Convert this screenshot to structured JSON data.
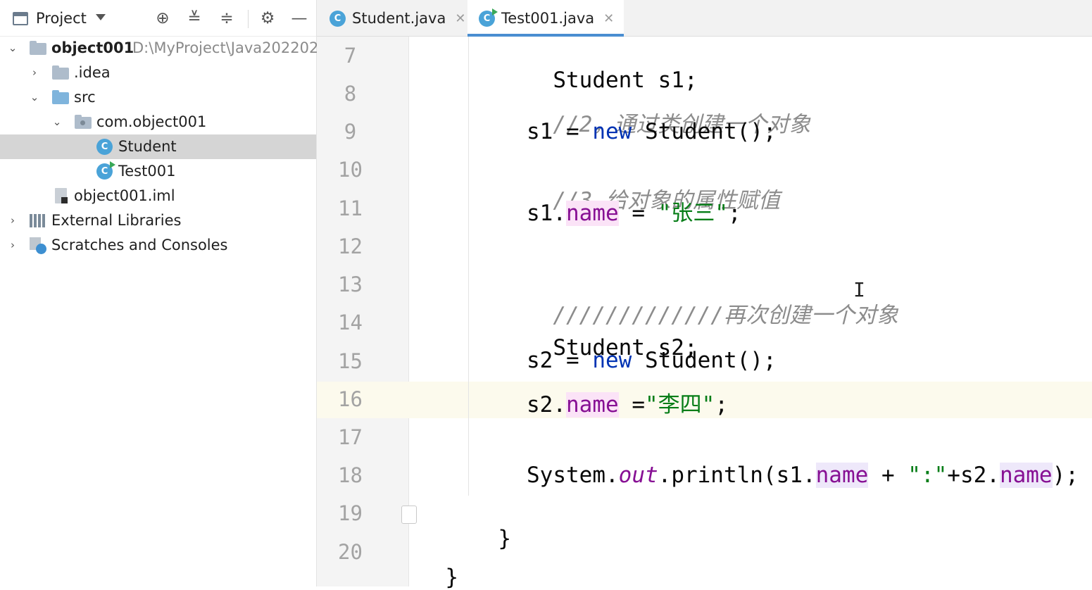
{
  "project_panel": {
    "title": "Project",
    "tree": [
      {
        "label": "object001",
        "path": "D:\\MyProject\\Java202202"
      },
      {
        "label": ".idea"
      },
      {
        "label": "src"
      },
      {
        "label": "com.object001"
      },
      {
        "label": "Student"
      },
      {
        "label": "Test001"
      },
      {
        "label": "object001.iml"
      },
      {
        "label": "External Libraries"
      },
      {
        "label": "Scratches and Consoles"
      }
    ]
  },
  "editor": {
    "tabs": [
      {
        "label": "Student.java"
      },
      {
        "label": "Test001.java"
      }
    ],
    "line_numbers": [
      "7",
      "8",
      "9",
      "10",
      "11",
      "12",
      "13",
      "14",
      "15",
      "16",
      "17",
      "18",
      "19",
      "20"
    ],
    "code": {
      "l7": "Student s1;",
      "l8": "//2，通过类创建一个对象",
      "l9_var": "s1 = ",
      "l9_kw": "new",
      "l9_rest": " Student();",
      "l10": "//3,给对象的属性赋值",
      "l11_obj": "s1.",
      "l11_field": "name",
      "l11_op": " = ",
      "l11_str": "\"张三\"",
      "l11_end": ";",
      "l13": "/////////////再次创建一个对象",
      "l14": "Student s2;",
      "l15_var": "s2 = ",
      "l15_kw": "new",
      "l15_rest": " Student();",
      "l16_obj": "s2.",
      "l16_field": "name",
      "l16_op": " =",
      "l16_str": "\"李四\"",
      "l16_end": ";",
      "l18_a": "System.",
      "l18_out": "out",
      "l18_b": ".println(s1.",
      "l18_f1": "name",
      "l18_c": " + ",
      "l18_str": "\":\"",
      "l18_d": "+s2.",
      "l18_f2": "name",
      "l18_e": ");",
      "l19": "}",
      "l20": "}"
    },
    "current_line": "16"
  },
  "colors": {
    "keyword": "#0033b3",
    "field": "#871094",
    "string": "#067d17",
    "comment": "#8c8c8c",
    "tab_underline": "#4a8ed1",
    "selection": "#d5d5d5"
  }
}
